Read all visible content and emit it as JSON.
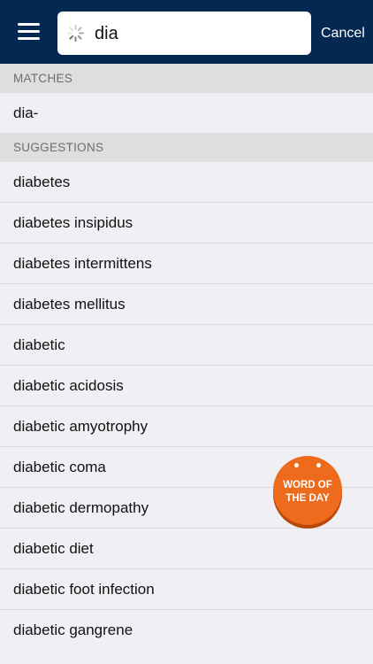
{
  "header": {
    "search_value": "dia",
    "cancel_label": "Cancel"
  },
  "matches": {
    "title": "MATCHES",
    "items": [
      "dia-"
    ]
  },
  "suggestions": {
    "title": "SUGGESTIONS",
    "items": [
      "diabetes",
      "diabetes insipidus",
      "diabetes intermittens",
      "diabetes mellitus",
      "diabetic",
      "diabetic acidosis",
      "diabetic amyotrophy",
      "diabetic coma",
      "diabetic dermopathy",
      "diabetic diet",
      "diabetic foot infection",
      "diabetic gangrene"
    ]
  },
  "word_of_day": {
    "line1": "WORD OF",
    "line2": "THE DAY"
  },
  "colors": {
    "header_bg": "#032851",
    "list_bg": "#f0eff4",
    "section_header_bg": "#dedede",
    "badge": "#ee6a1c"
  }
}
